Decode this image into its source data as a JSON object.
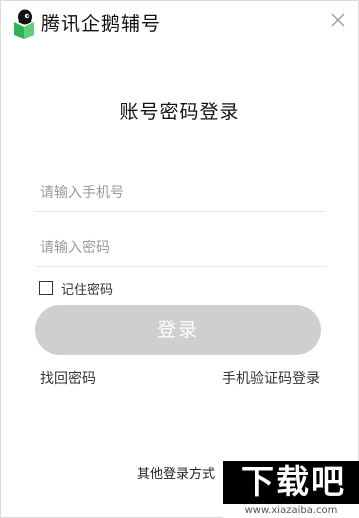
{
  "window": {
    "app_title": "腾讯企鹅辅号",
    "close_icon": "close-icon",
    "logo_icon": "penguin-logo-icon"
  },
  "login": {
    "title": "账号密码登录",
    "phone_placeholder": "请输入手机号",
    "phone_value": "",
    "password_placeholder": "请输入密码",
    "password_value": "",
    "remember_label": "记住密码",
    "remember_checked": false,
    "submit_label": "登录",
    "recover_link": "找回密码",
    "sms_login_link": "手机验证码登录",
    "other_login": "其他登录方式"
  },
  "watermark": {
    "text": "下载吧",
    "url": "www.xiazaiba.com"
  },
  "colors": {
    "button_disabled_bg": "#cfcfcf",
    "logo_green": "#2fb35a",
    "logo_black": "#111111",
    "input_underline": "#e6e6e6"
  }
}
